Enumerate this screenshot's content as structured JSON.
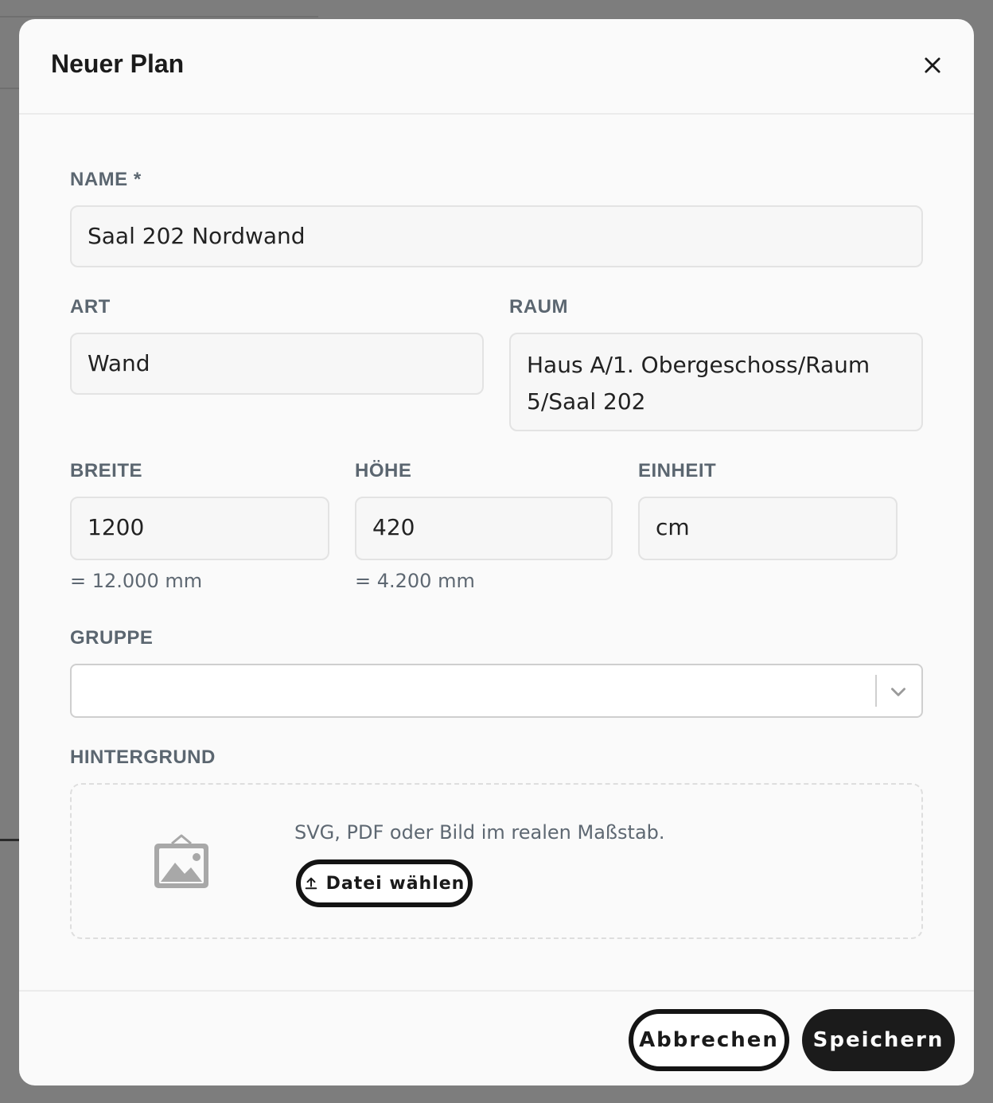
{
  "dialog": {
    "title": "Neuer Plan",
    "close_icon": "close-icon"
  },
  "form": {
    "name": {
      "label": "NAME *",
      "value": "Saal 202 Nordwand"
    },
    "art": {
      "label": "ART",
      "value": "Wand"
    },
    "raum": {
      "label": "RAUM",
      "value_line1": "Haus A/1. Obergeschoss/Raum",
      "value_line2": "5/Saal 202"
    },
    "breite": {
      "label": "BREITE",
      "value": "1200",
      "hint": "= 12.000 mm"
    },
    "hoehe": {
      "label": "HÖHE",
      "value": "420",
      "hint": "= 4.200 mm"
    },
    "einheit": {
      "label": "EINHEIT",
      "value": "cm"
    },
    "gruppe": {
      "label": "GRUPPE",
      "value": "",
      "icon": "chevron-down-icon"
    },
    "hintergrund": {
      "label": "HINTERGRUND",
      "description": "SVG, PDF oder Bild im realen Maßstab.",
      "button_label": "Datei wählen",
      "image_icon": "image-placeholder-icon",
      "upload_icon": "upload-icon"
    }
  },
  "footer": {
    "cancel_label": "Abbrechen",
    "save_label": "Speichern"
  },
  "colors": {
    "overlay": "#7d7d7d",
    "modal_bg": "#fafafa",
    "primary_button": "#1b1b1b",
    "label_text": "#5b6670"
  }
}
